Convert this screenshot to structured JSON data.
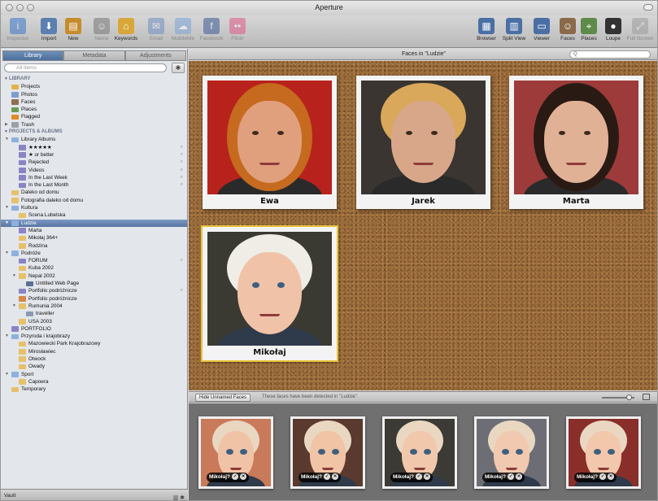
{
  "window": {
    "title": "Aperture"
  },
  "toolbar": {
    "left": [
      {
        "label": "Inspector",
        "icon": "info-icon",
        "color": "#3b76c9",
        "enabled": false
      },
      {
        "label": "Import",
        "icon": "import-arrow-icon",
        "color": "#5a7fb0",
        "enabled": true
      },
      {
        "label": "New",
        "icon": "new-project-icon",
        "color": "#c58b2d",
        "enabled": true
      },
      {
        "label": "Name",
        "icon": "name-person-icon",
        "color": "#777777",
        "enabled": false
      },
      {
        "label": "Keywords",
        "icon": "keyword-tag-icon",
        "color": "#d8a73a",
        "enabled": true
      },
      {
        "label": "Email",
        "icon": "email-icon",
        "color": "#6f8fbf",
        "enabled": false
      },
      {
        "label": "MobileMe",
        "icon": "mobileme-cloud-icon",
        "color": "#7aa6d8",
        "enabled": false
      },
      {
        "label": "Facebook",
        "icon": "facebook-icon",
        "color": "#3b5998",
        "enabled": false
      },
      {
        "label": "Flickr",
        "icon": "flickr-icon",
        "color": "#e05a8b",
        "enabled": false
      }
    ],
    "right": [
      {
        "label": "Browser",
        "icon": "browser-grid-icon",
        "color": "#4a6fa5",
        "enabled": true
      },
      {
        "label": "Split View",
        "icon": "split-view-icon",
        "color": "#4a6fa5",
        "enabled": true
      },
      {
        "label": "Viewer",
        "icon": "viewer-icon",
        "color": "#4a6fa5",
        "enabled": true
      },
      {
        "label": "Faces",
        "icon": "faces-icon",
        "color": "#8a6a4a",
        "enabled": true
      },
      {
        "label": "Places",
        "icon": "places-map-icon",
        "color": "#5f8a4a",
        "enabled": true
      },
      {
        "label": "Loupe",
        "icon": "loupe-icon",
        "color": "#333333",
        "enabled": true
      },
      {
        "label": "Full Screen",
        "icon": "full-screen-icon",
        "color": "#999999",
        "enabled": false
      }
    ]
  },
  "sidebar": {
    "tabs": [
      {
        "label": "Library",
        "active": true
      },
      {
        "label": "Metadata",
        "active": false
      },
      {
        "label": "Adjustments",
        "active": false
      }
    ],
    "search_placeholder": "All Items",
    "tree": [
      {
        "label": "LIBRARY",
        "type": "header",
        "indent": 0,
        "disclosure": "open"
      },
      {
        "label": "Projects",
        "icon": "projects-folder-icon",
        "indent": 1
      },
      {
        "label": "Photos",
        "icon": "photos-icon",
        "indent": 1
      },
      {
        "label": "Faces",
        "icon": "faces-icon",
        "indent": 1
      },
      {
        "label": "Places",
        "icon": "places-icon",
        "indent": 1
      },
      {
        "label": "Flagged",
        "icon": "flag-icon",
        "indent": 1
      },
      {
        "label": "Trash",
        "icon": "trash-icon",
        "indent": 1,
        "disclosure": "closed"
      },
      {
        "label": "PROJECTS & ALBUMS",
        "type": "header",
        "indent": 0,
        "disclosure": "open"
      },
      {
        "label": "Library Albums",
        "icon": "folder-icon",
        "indent": 1,
        "disclosure": "open"
      },
      {
        "label": "★★★★★",
        "icon": "smart-album-icon",
        "indent": 2,
        "search": true
      },
      {
        "label": "★ or better",
        "icon": "smart-album-icon",
        "indent": 2,
        "search": true
      },
      {
        "label": "Rejected",
        "icon": "smart-album-icon",
        "indent": 2,
        "search": true
      },
      {
        "label": "Videos",
        "icon": "smart-album-icon",
        "indent": 2,
        "search": true
      },
      {
        "label": "In the Last Week",
        "icon": "smart-album-icon",
        "indent": 2,
        "search": true
      },
      {
        "label": "In the Last Month",
        "icon": "smart-album-icon",
        "indent": 2,
        "search": true
      },
      {
        "label": "Daleko od domu",
        "icon": "project-icon",
        "indent": 1
      },
      {
        "label": "Fotografia daleko od domu",
        "icon": "project-icon",
        "indent": 1
      },
      {
        "label": "Kultura",
        "icon": "folder-icon",
        "indent": 1,
        "disclosure": "open"
      },
      {
        "label": "Scena Lubelska",
        "icon": "project-icon",
        "indent": 2
      },
      {
        "label": "Ludzie",
        "icon": "folder-icon",
        "indent": 1,
        "disclosure": "open",
        "selected": true
      },
      {
        "label": "Marta",
        "icon": "smart-album-icon",
        "indent": 2
      },
      {
        "label": "Mikołaj 364+",
        "icon": "project-icon",
        "indent": 2
      },
      {
        "label": "Rodzina",
        "icon": "project-icon",
        "indent": 2
      },
      {
        "label": "Podróże",
        "icon": "folder-icon",
        "indent": 1,
        "disclosure": "open"
      },
      {
        "label": "FORUM",
        "icon": "smart-album-icon",
        "indent": 2,
        "search": true
      },
      {
        "label": "Kuba 2002",
        "icon": "project-icon",
        "indent": 2
      },
      {
        "label": "Nepal 2002",
        "icon": "project-icon",
        "indent": 2,
        "disclosure": "open"
      },
      {
        "label": "Untitled Web Page",
        "icon": "web-page-icon",
        "indent": 3
      },
      {
        "label": "Portfolio podróżnicze",
        "icon": "smart-album-icon",
        "indent": 2,
        "search": true
      },
      {
        "label": "Portfolio podróżnicze",
        "icon": "book-icon",
        "indent": 2
      },
      {
        "label": "Rumunia 2004",
        "icon": "project-icon",
        "indent": 2,
        "disclosure": "open"
      },
      {
        "label": "traveller",
        "icon": "web-journal-icon",
        "indent": 3
      },
      {
        "label": "USA 2003",
        "icon": "project-icon",
        "indent": 2
      },
      {
        "label": "PORTFOLIO",
        "icon": "smart-album-icon",
        "indent": 1
      },
      {
        "label": "Przyroda i krajobrazy",
        "icon": "folder-icon",
        "indent": 1,
        "disclosure": "open"
      },
      {
        "label": "Mazowiecki Park Krajobrazowy",
        "icon": "project-icon",
        "indent": 2
      },
      {
        "label": "Mirosławiec",
        "icon": "project-icon",
        "indent": 2
      },
      {
        "label": "Otwock",
        "icon": "project-icon",
        "indent": 2
      },
      {
        "label": "Owady",
        "icon": "project-icon",
        "indent": 2
      },
      {
        "label": "Sport",
        "icon": "folder-icon",
        "indent": 1,
        "disclosure": "open"
      },
      {
        "label": "Capoera",
        "icon": "project-icon",
        "indent": 2
      },
      {
        "label": "Temporary",
        "icon": "project-icon",
        "indent": 1
      }
    ],
    "vault_label": "Vault"
  },
  "main": {
    "title": "Faces in \"Ludzie\"",
    "search_placeholder": "Q",
    "faces": [
      {
        "name": "Ewa",
        "hair": "#c56a1f",
        "skin": "#e0a07d",
        "bg": "#b8221c",
        "selected": false
      },
      {
        "name": "Jarek",
        "hair": "#d9a85a",
        "skin": "#d8a78a",
        "bg": "#3a3530",
        "selected": false
      },
      {
        "name": "Marta",
        "hair": "#2a1a14",
        "skin": "#e1b196",
        "bg": "#9c3b3a",
        "selected": false
      },
      {
        "name": "Mikołaj",
        "hair": "#f0ece6",
        "skin": "#f0c2a8",
        "bg": "#3a3a32",
        "selected": true
      }
    ]
  },
  "unnamed": {
    "hide_button": "Hide Unnamed Faces",
    "message": "These faces have been detected in \"Ludzie\"",
    "items": [
      {
        "label": "Mikołaj?",
        "skin": "#f1c3a6",
        "bg": "#c97a5a"
      },
      {
        "label": "Mikołaj?",
        "skin": "#f0c4a5",
        "bg": "#5a3a2e"
      },
      {
        "label": "Mikołaj?",
        "skin": "#f2c8ac",
        "bg": "#3c3a34"
      },
      {
        "label": "Mikołaj?",
        "skin": "#f0c9b0",
        "bg": "#6d6e75"
      },
      {
        "label": "Mikołaj?",
        "skin": "#f3c7ab",
        "bg": "#8a2e2a"
      }
    ]
  }
}
